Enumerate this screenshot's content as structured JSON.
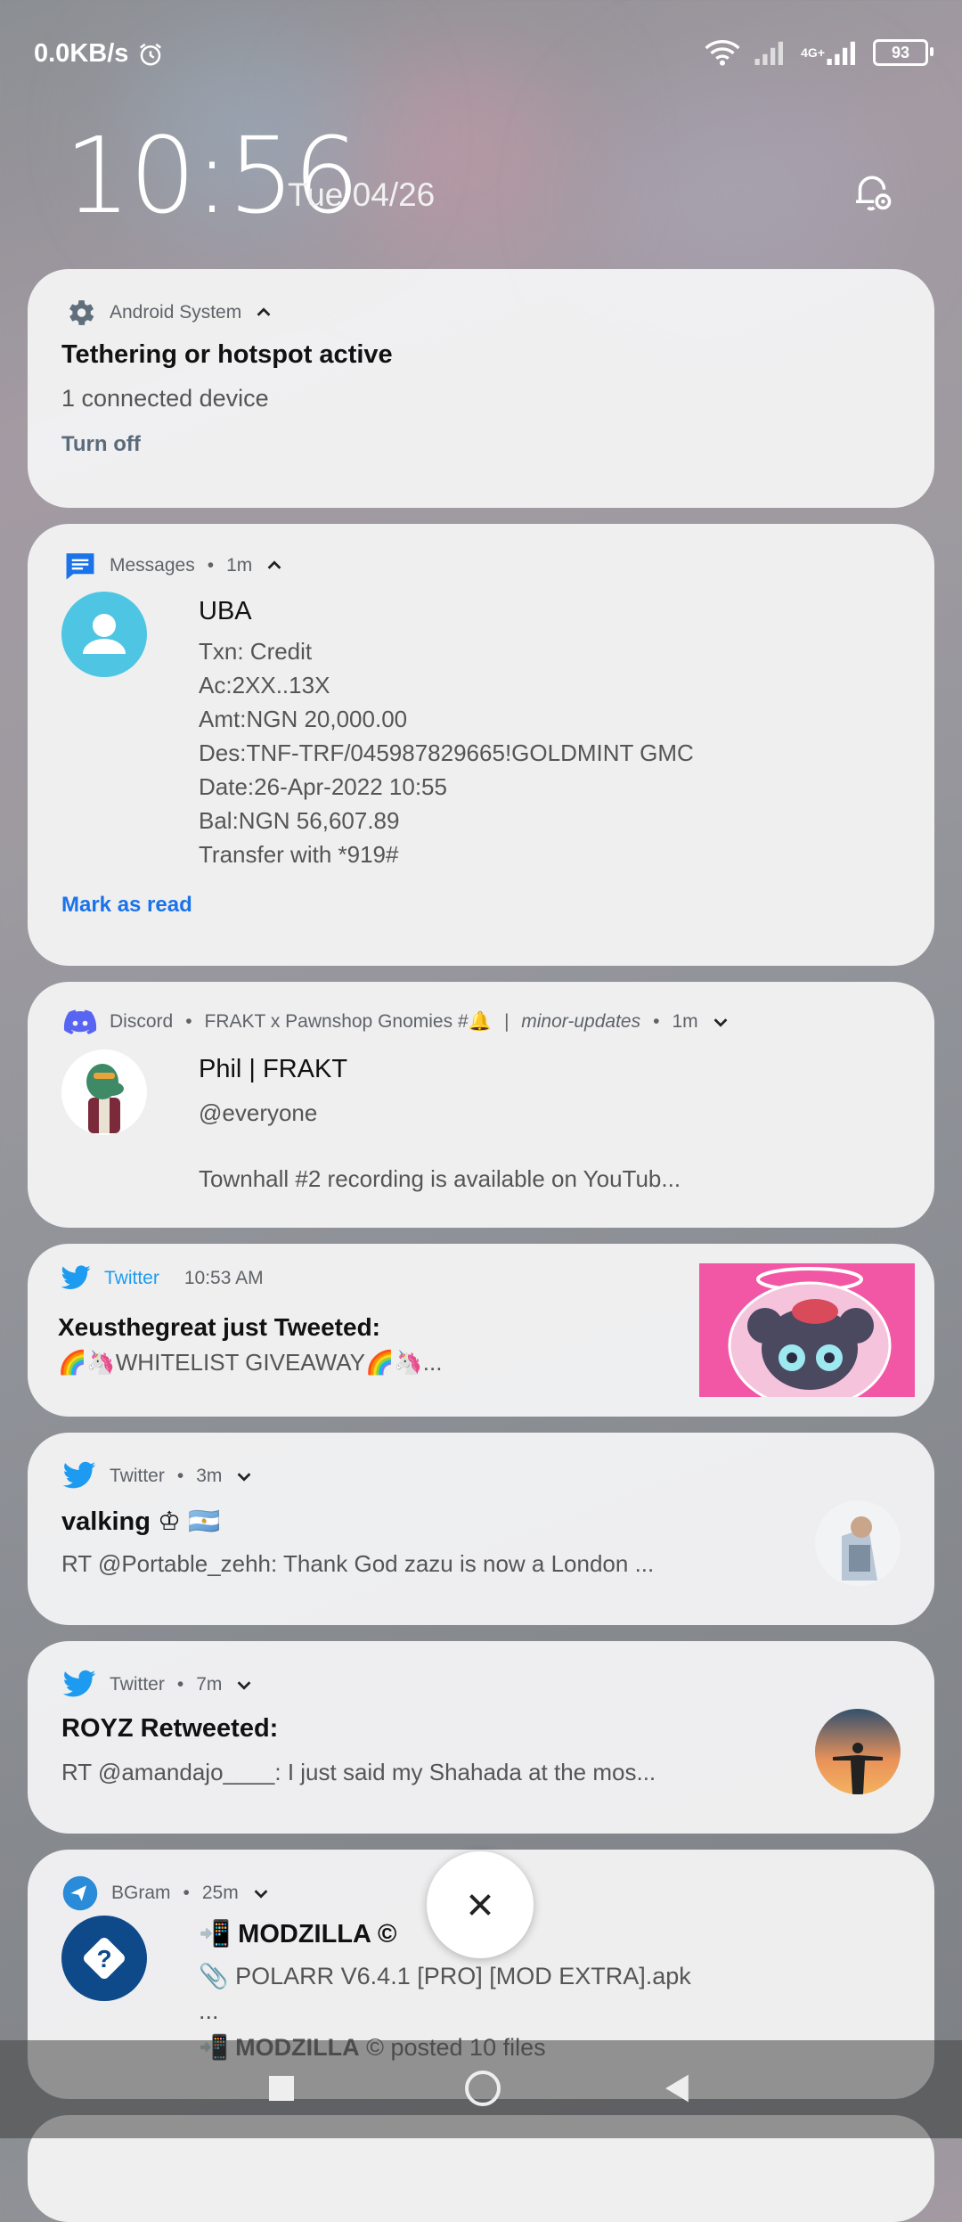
{
  "status_bar": {
    "speed": "0.0KB/s",
    "network": "4G+",
    "battery": "93"
  },
  "lock": {
    "time": "10:56",
    "date": "Tue 04/26"
  },
  "notifications": {
    "android": {
      "app": "Android System",
      "title": "Tethering or hotspot active",
      "text": "1 connected device",
      "action": "Turn off"
    },
    "messages": {
      "app": "Messages",
      "time": "1m",
      "sender": "UBA",
      "lines": [
        "Txn: Credit",
        "Ac:2XX..13X",
        "Amt:NGN 20,000.00",
        "Des:TNF-TRF/045987829665!GOLDMINT GMC",
        "Date:26-Apr-2022 10:55",
        "Bal:NGN 56,607.89",
        "Transfer with *919#"
      ],
      "action": "Mark as read"
    },
    "discord": {
      "app": "Discord",
      "channel_prefix": "FRAKT x Pawnshop Gnomies #🔔",
      "channel_suffix": "minor-updates",
      "time": "1m",
      "title": "Phil | FRAKT",
      "mention": "@everyone",
      "text": "Townhall #2 recording is available on YouTub..."
    },
    "twitter1": {
      "app": "Twitter",
      "time": "10:53 AM",
      "title": "Xeusthegreat just Tweeted:",
      "text": "🌈🦄WHITELIST GIVEAWAY🌈🦄..."
    },
    "twitter2": {
      "app": "Twitter",
      "time": "3m",
      "title": "valking ♔ 🇦🇷",
      "text": "RT @Portable_zehh: Thank God zazu is now a London ..."
    },
    "twitter3": {
      "app": "Twitter",
      "time": "7m",
      "title": "ROYZ Retweeted:",
      "text": "RT @amandajo____: I just said my Shahada at the mos..."
    },
    "bgram": {
      "app": "BGram",
      "time": "25m",
      "title": "📲 MODZILLA ©",
      "line1": "📎 POLARR V6.4.1 [PRO] [MOD EXTRA].apk",
      "line2": "...",
      "line3_bold": "📲 MODZILLA",
      "line3_rest": " © posted 10 files"
    }
  },
  "colors": {
    "accent_link": "#1a73e8",
    "twitter_blue": "#1d9bf0",
    "discord_blue": "#5865f2"
  }
}
